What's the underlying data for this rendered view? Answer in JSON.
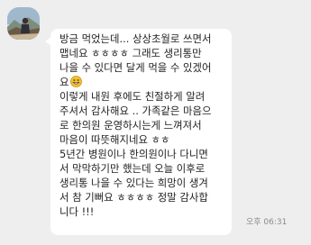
{
  "message": {
    "lines": [
      "방금 먹었는데... 상상초월로 쓰면서",
      "맵네요 ㅎㅎㅎㅎ 그래도 생리통만",
      "나을 수 있다면 달게 먹을 수 있겠어",
      "요",
      "이렇게 내원 후에도 친절하게 알려",
      "주셔서 감사해요 .. 가족같은 마음으",
      "로 한의원 운영하시는게 느껴져서",
      "마음이 따뜻해지네요 ㅎㅎ",
      "5년간 병원이나 한의원이나 다니면",
      "서 막막하기만 했는데 오늘 이후로",
      "생리통 나을 수 있다는 희망이 생겨",
      "서 참 기뻐요 ㅎㅎㅎㅎ 정말 감사합",
      "니다 !!!"
    ],
    "emoji": "grinning-face-emoji",
    "time": "오후 06:31"
  },
  "colors": {
    "background": "#eeeeee",
    "bubble": "#ffffff",
    "text": "#222222",
    "time": "#8a8a8a"
  }
}
